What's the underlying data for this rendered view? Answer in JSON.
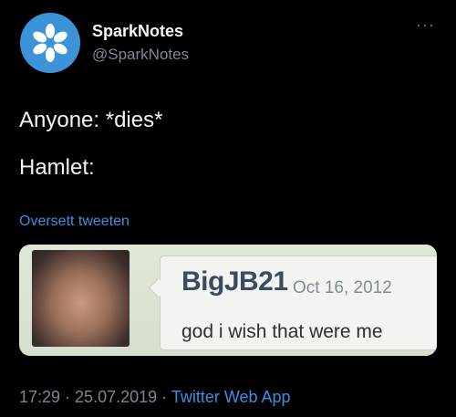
{
  "tweet": {
    "display_name": "SparkNotes",
    "handle": "@SparkNotes",
    "line1": "Anyone: *dies*",
    "line2": "Hamlet:",
    "translate_link": "Oversett tweeten",
    "time": "17:29",
    "separator": " · ",
    "date": "25.07.2019",
    "separator2": " · ",
    "app": "Twitter Web App"
  },
  "quoted": {
    "username": "BigJB21",
    "date": "Oct 16, 2012",
    "text": "god i wish that were me"
  },
  "icons": {
    "avatar": "sparknotes-logo-icon",
    "more": "more-options-icon"
  },
  "colors": {
    "background": "#000000",
    "avatar_blue": "#3c93d7",
    "link_blue": "#3d8fe0",
    "muted_gray": "#7b8a97"
  }
}
